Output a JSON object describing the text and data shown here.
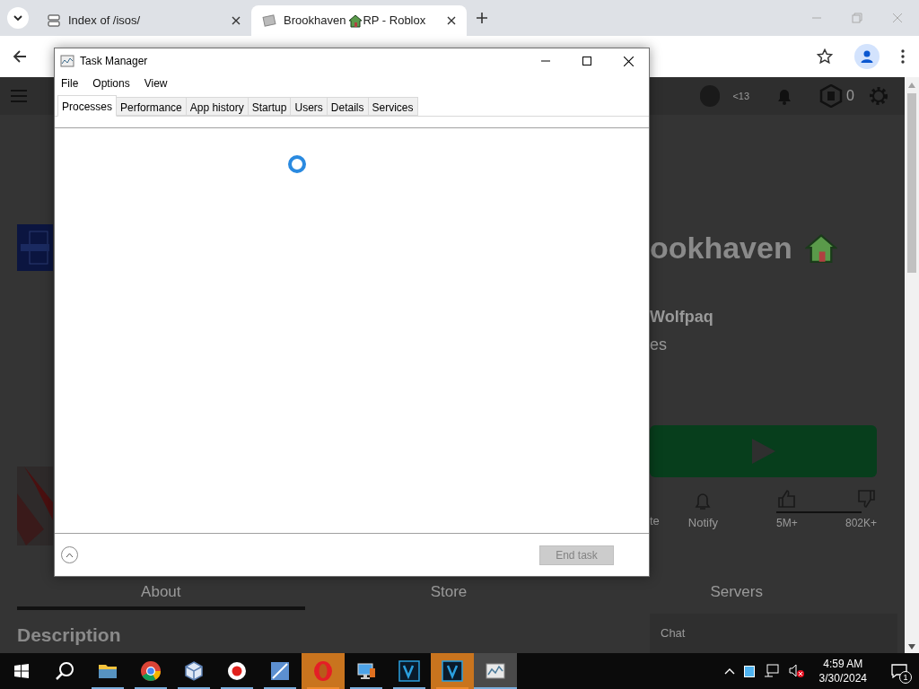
{
  "browser": {
    "tabs": [
      {
        "title": "Index of /isos/",
        "selected": false
      },
      {
        "title": "Brookhaven",
        "title_suffix": "RP - Roblox",
        "selected": true
      }
    ]
  },
  "roblox": {
    "age_badge": "<13",
    "robux": "0",
    "game_title": "ookhaven",
    "creator": "Wolfpaq",
    "subline": "es",
    "actions": [
      {
        "kind": "text",
        "label": "te"
      },
      {
        "kind": "bell",
        "label": "Notify"
      }
    ],
    "votes": {
      "up": "5M+",
      "down": "802K+"
    },
    "tabs": [
      {
        "label": "About",
        "selected": true
      },
      {
        "label": "Store",
        "selected": false
      },
      {
        "label": "Servers",
        "selected": false
      }
    ],
    "section": "Description",
    "chat": "Chat"
  },
  "task_manager": {
    "title": "Task Manager",
    "menu": [
      "File",
      "Options",
      "View"
    ],
    "tabs": [
      {
        "label": "Processes",
        "selected": true
      },
      {
        "label": "Performance",
        "selected": false
      },
      {
        "label": "App history",
        "selected": false
      },
      {
        "label": "Startup",
        "selected": false
      },
      {
        "label": "Users",
        "selected": false
      },
      {
        "label": "Details",
        "selected": false
      },
      {
        "label": "Services",
        "selected": false
      }
    ],
    "loading": true,
    "end_task": {
      "label": "End task",
      "disabled": true
    }
  },
  "taskbar": {
    "apps": [
      {
        "kind": "explorer",
        "flashing": false,
        "selected": false
      },
      {
        "kind": "chrome",
        "flashing": false,
        "selected": false
      },
      {
        "kind": "cube",
        "flashing": false,
        "selected": false
      },
      {
        "kind": "record",
        "flashing": false,
        "selected": false
      },
      {
        "kind": "seven",
        "flashing": false,
        "selected": false
      },
      {
        "kind": "opera",
        "flashing": true,
        "selected": false
      },
      {
        "kind": "monitor",
        "flashing": false,
        "selected": false
      },
      {
        "kind": "v18",
        "flashing": false,
        "selected": false
      },
      {
        "kind": "v",
        "flashing": true,
        "selected": false
      },
      {
        "kind": "taskmgr",
        "flashing": false,
        "selected": true
      }
    ],
    "time": "4:59 AM",
    "date": "3/30/2024",
    "notifications": "1"
  }
}
